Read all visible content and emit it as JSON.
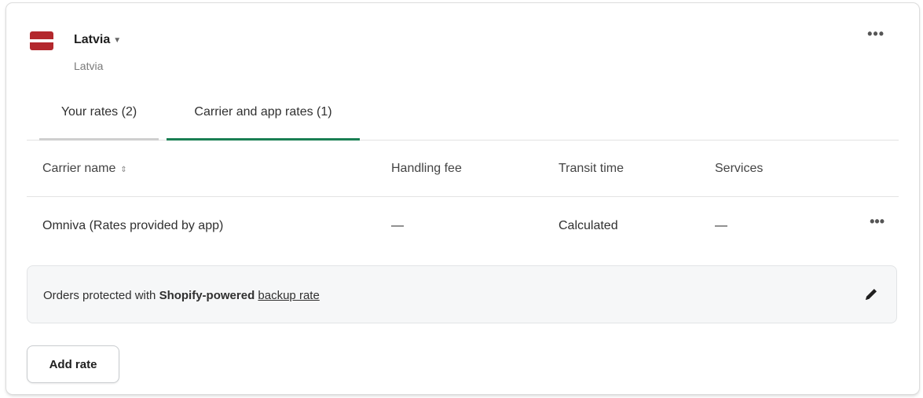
{
  "zone": {
    "name": "Latvia",
    "subtitle": "Latvia",
    "flag_colors": {
      "band": "#b3282d",
      "middle": "#ffffff"
    }
  },
  "menu": {
    "more_label": "•••"
  },
  "tabs": [
    {
      "label": "Your rates (2)",
      "selected": false
    },
    {
      "label": "Carrier and app rates (1)",
      "selected": true
    }
  ],
  "table": {
    "headers": {
      "carrier": "Carrier name",
      "fee": "Handling fee",
      "transit": "Transit time",
      "services": "Services"
    },
    "sort_icon": "⇕",
    "rows": [
      {
        "carrier": "Omniva (Rates provided by app)",
        "fee": "—",
        "transit": "Calculated",
        "services": "—"
      }
    ]
  },
  "backup": {
    "prefix": "Orders protected with ",
    "brand": "Shopify-powered",
    "link": "backup rate",
    "edit_icon": "pencil-icon"
  },
  "actions": {
    "add_rate": "Add rate"
  },
  "colors": {
    "accent": "#1a7f53",
    "tab_inactive_underline": "#cfcfcf"
  }
}
